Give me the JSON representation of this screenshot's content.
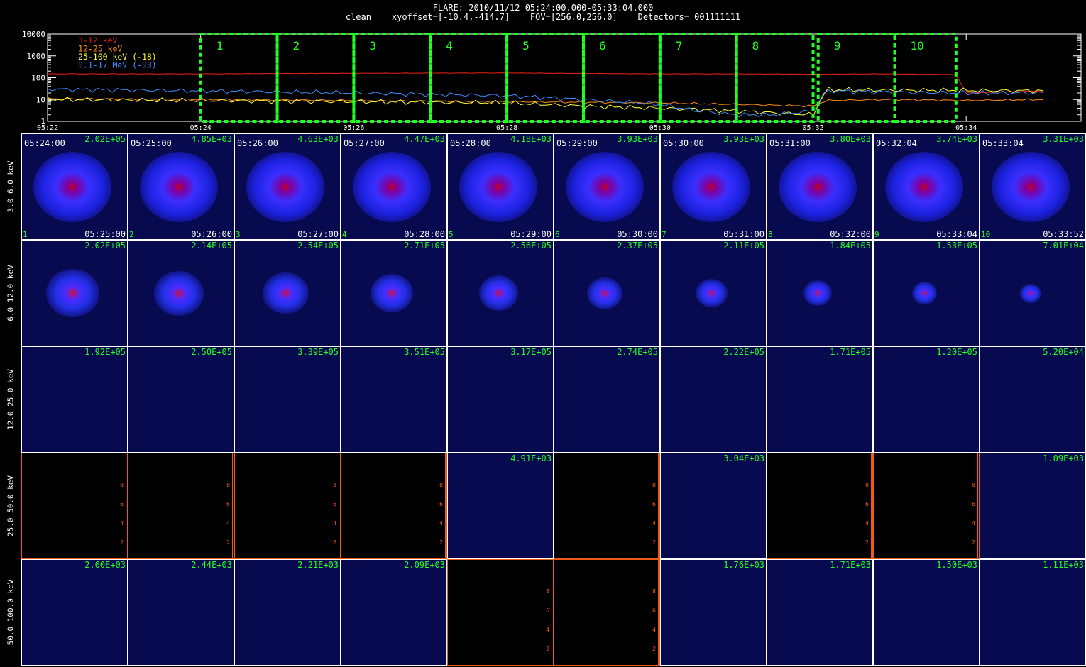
{
  "title": {
    "line1": "FLARE: 2010/11/12 05:24:00.000-05:33:04.000",
    "line2": "clean    xyoffset=[-10.4,-414.7]    FOV=[256.0,256.0]    Detectors= 001111111"
  },
  "colors": {
    "green": "#22ff22",
    "axis": "#ffffff",
    "empty_axis": "#f05a14"
  },
  "chart_data": [
    {
      "type": "line",
      "title": "",
      "ylog": true,
      "ylim": [
        1,
        10000
      ],
      "yticks": [
        "1",
        "10",
        "100",
        "1000",
        "10000"
      ],
      "xlim_minutes": [
        "05:22",
        "05:35:30"
      ],
      "xticks": [
        "05:22",
        "05:24",
        "05:26",
        "05:28",
        "05:30",
        "05:32",
        "05:34"
      ],
      "series": [
        {
          "name": "3-12 keV",
          "color": "#ee2211",
          "times": [
            "05:22",
            "05:24",
            "05:26",
            "05:28",
            "05:30",
            "05:31",
            "05:32",
            "05:33",
            "05:33:52",
            "05:34",
            "05:35"
          ],
          "values": [
            150,
            150,
            160,
            165,
            150,
            150,
            145,
            150,
            140,
            20,
            25
          ]
        },
        {
          "name": "12-25 keV",
          "color": "#ff8c1a",
          "times": [
            "05:22",
            "05:24",
            "05:26",
            "05:28",
            "05:30",
            "05:31",
            "05:32",
            "05:32:10",
            "05:33",
            "05:34",
            "05:35"
          ],
          "values": [
            11,
            10,
            9,
            8,
            7,
            6,
            5,
            9,
            10,
            9,
            10
          ]
        },
        {
          "name": "25-100 keV (-18)",
          "color": "#ffff33",
          "times": [
            "05:22",
            "05:24",
            "05:26",
            "05:28",
            "05:29",
            "05:30",
            "05:31",
            "05:32",
            "05:32:10",
            "05:33",
            "05:34",
            "05:35"
          ],
          "values": [
            10,
            9,
            8,
            7,
            5,
            4,
            3,
            2,
            28,
            27,
            26,
            25
          ]
        },
        {
          "name": "0.1-17 MeV (-93)",
          "color": "#3f8fff",
          "times": [
            "05:22",
            "05:24",
            "05:26",
            "05:28",
            "05:29",
            "05:30",
            "05:30:30",
            "05:31",
            "05:31:30",
            "05:32",
            "05:32:10",
            "05:33",
            "05:34",
            "05:35"
          ],
          "values": [
            30,
            25,
            20,
            15,
            10,
            6,
            3,
            2,
            2,
            3,
            25,
            22,
            20,
            20
          ]
        }
      ],
      "intervals": [
        "1",
        "2",
        "3",
        "4",
        "5",
        "6",
        "7",
        "8",
        "9",
        "10"
      ]
    },
    {
      "type": "heatmap",
      "rows": [
        "3.0-6.0 keV",
        "6.0-12.0 keV",
        "12.0-25.0 keV",
        "25.0-50.0 keV",
        "50.0-100.0 keV"
      ],
      "start_times": [
        "05:24:00",
        "05:25:00",
        "05:26:00",
        "05:27:00",
        "05:28:00",
        "05:29:00",
        "05:30:00",
        "05:31:00",
        "05:32:04",
        "05:33:04"
      ],
      "end_times": [
        "05:25:00",
        "05:26:00",
        "05:27:00",
        "05:28:00",
        "05:29:00",
        "05:30:00",
        "05:31:00",
        "05:32:00",
        "05:33:04",
        "05:33:52"
      ],
      "peaks": [
        [
          "2.02E+05",
          "4.85E+03",
          "4.63E+03",
          "4.47E+03",
          "4.18E+03",
          "3.93E+03",
          "3.93E+03",
          "3.80E+03",
          "3.74E+03",
          "3.31E+03"
        ],
        [
          "2.02E+05",
          "2.14E+05",
          "2.54E+05",
          "2.71E+05",
          "2.56E+05",
          "2.37E+05",
          "2.11E+05",
          "1.84E+05",
          "1.53E+05",
          "7.01E+04"
        ],
        [
          "1.92E+05",
          "2.50E+05",
          "3.39E+05",
          "3.51E+05",
          "3.17E+05",
          "2.74E+05",
          "2.22E+05",
          "1.71E+05",
          "1.20E+05",
          "5.20E+04"
        ],
        [
          "",
          "",
          "",
          "",
          "4.91E+03",
          "",
          "3.04E+03",
          "",
          "",
          "1.09E+03"
        ],
        [
          "2.60E+03",
          "2.44E+03",
          "2.21E+03",
          "2.09E+03",
          "",
          "",
          "1.76E+03",
          "1.71E+03",
          "1.50E+03",
          "1.11E+03"
        ]
      ],
      "empty_tick_labels": [
        "2",
        "4",
        "6",
        "8"
      ]
    }
  ]
}
